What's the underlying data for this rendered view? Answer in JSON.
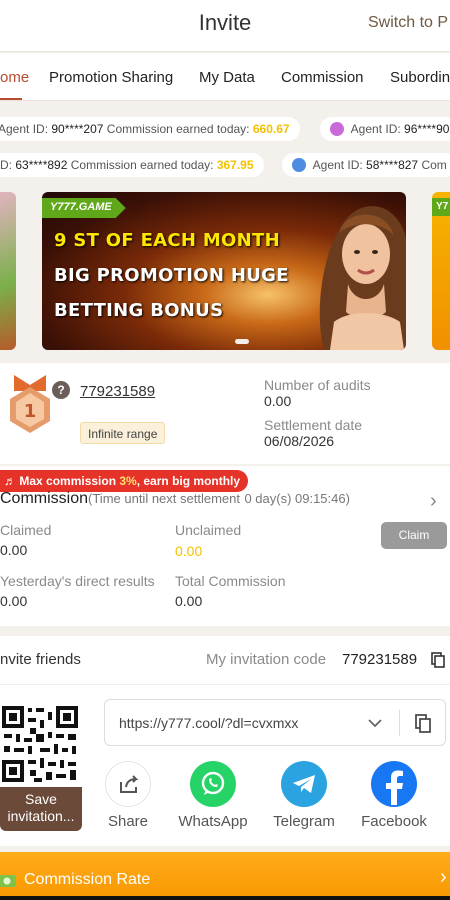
{
  "header": {
    "title": "Invite",
    "switch_label": "Switch to P"
  },
  "tabs": [
    "ome",
    "Promotion Sharing",
    "My Data",
    "Commission",
    "Subordina"
  ],
  "ticker": {
    "row1": [
      {
        "prefix": "Agent ID:",
        "id": "90****207",
        "label": "Commission earned today:",
        "amount": "660.67"
      },
      {
        "prefix": "Agent ID:",
        "id": "96****90",
        "label": "",
        "amount": ""
      }
    ],
    "row2": [
      {
        "prefix": "D:",
        "id": "63****892",
        "label": "Commission earned today:",
        "amount": "367.95"
      },
      {
        "prefix": "Agent ID:",
        "id": "58****827",
        "label": "Com",
        "amount": ""
      }
    ]
  },
  "banner": {
    "logo": "Y777.GAME",
    "side_logo": "Y7",
    "line1": "9 ST OF EACH MONTH",
    "line2": "BIG PROMOTION HUGE",
    "line3": "BETTING BONUS"
  },
  "agent": {
    "rank": "1",
    "help_mark": "?",
    "id": "779231589",
    "range_label": "Infinite range",
    "audits_label": "Number of audits",
    "audits_value": "0.00",
    "settlement_label": "Settlement date",
    "settlement_value": "06/08/2026"
  },
  "commission": {
    "badge_prefix": "Max commission ",
    "badge_rate": "3%",
    "badge_suffix": ", earn big monthly",
    "title": "Commission",
    "timer_label": "(Time until next settlement",
    "timer_value": "0 day(s) 09:15:46)",
    "claimed_label": "Claimed",
    "claimed_value": "0.00",
    "unclaimed_label": "Unclaimed",
    "unclaimed_value": "0.00",
    "claim_button": "Claim",
    "yesterday_label": "Yesterday's direct results",
    "yesterday_value": "0.00",
    "total_label": "Total Commission",
    "total_value": "0.00"
  },
  "invite": {
    "title": "nvite friends",
    "code_label": "My invitation code",
    "code_value": "779231589",
    "save_button_line1": "Save",
    "save_button_line2": "invitation...",
    "url": "https://y777.cool/?dl=cvxmxx",
    "share_items": [
      "Share",
      "WhatsApp",
      "Telegram",
      "Facebook"
    ]
  },
  "bottom": {
    "label": "Commission Rate"
  },
  "colors": {
    "accent": "#b84c2e",
    "gold": "#f2c200",
    "orange": "#f89800",
    "whatsapp": "#25d366",
    "telegram": "#2aa3e0",
    "facebook": "#1877f2"
  }
}
